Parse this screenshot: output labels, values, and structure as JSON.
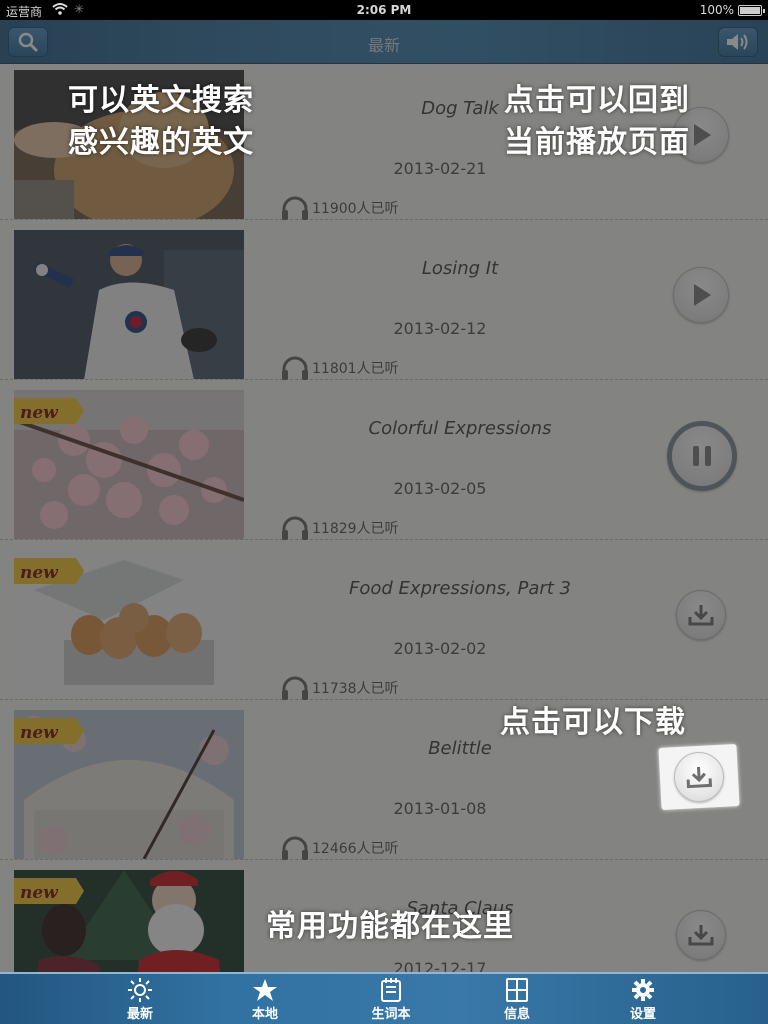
{
  "status_bar": {
    "carrier": "运营商",
    "time": "2:06 PM",
    "battery": "100%"
  },
  "header": {
    "title": "最新"
  },
  "items": [
    {
      "title": "Dog Talk",
      "date": "2013-02-21",
      "listeners": "11900人已听",
      "action": "play",
      "new": false
    },
    {
      "title": "Losing It",
      "date": "2013-02-12",
      "listeners": "11801人已听",
      "action": "play",
      "new": false
    },
    {
      "title": "Colorful Expressions",
      "date": "2013-02-05",
      "listeners": "11829人已听",
      "action": "pause",
      "new": true,
      "badge": "new"
    },
    {
      "title": "Food Expressions, Part 3",
      "date": "2013-02-02",
      "listeners": "11738人已听",
      "action": "download",
      "new": true,
      "badge": "new"
    },
    {
      "title": "Belittle",
      "date": "2013-01-08",
      "listeners": "12466人已听",
      "action": "download",
      "new": true,
      "badge": "new"
    },
    {
      "title": "Santa Claus",
      "date": "2012-12-17",
      "listeners": "",
      "action": "download",
      "new": true,
      "badge": "new"
    }
  ],
  "tips": {
    "search_line1": "可以英文搜索",
    "search_line2": "感兴趣的英文",
    "player_line1": "点击可以回到",
    "player_line2": "当前播放页面",
    "download": "点击可以下载",
    "tabs": "常用功能都在这里"
  },
  "tabbar": [
    {
      "label": "最新",
      "icon": "sun-icon"
    },
    {
      "label": "本地",
      "icon": "star-icon"
    },
    {
      "label": "生词本",
      "icon": "notebook-icon"
    },
    {
      "label": "信息",
      "icon": "info-grid-icon"
    },
    {
      "label": "设置",
      "icon": "gear-icon"
    }
  ]
}
